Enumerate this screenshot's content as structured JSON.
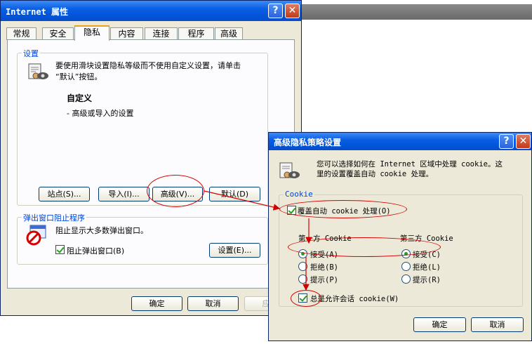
{
  "main_dialog": {
    "title": "Internet 属性",
    "help_label": "?",
    "close_label": "✕",
    "tabs": [
      {
        "label": "常规",
        "active": false
      },
      {
        "label": "安全",
        "active": false
      },
      {
        "label": "隐私",
        "active": true
      },
      {
        "label": "内容",
        "active": false
      },
      {
        "label": "连接",
        "active": false
      },
      {
        "label": "程序",
        "active": false
      },
      {
        "label": "高级",
        "active": false
      }
    ],
    "settings_group": {
      "label": "设置",
      "description": "要使用滑块设置隐私等级而不使用自定义设置，请单击\n“默认”按钮。",
      "level_title": "自定义",
      "level_desc": "- 高级或导入的设置",
      "buttons": {
        "sites": "站点(S)...",
        "import": "导入(I)...",
        "advanced": "高级(V)...",
        "default": "默认(D)"
      }
    },
    "popup_group": {
      "label": "弹出窗口阻止程序",
      "description": "阻止显示大多数弹出窗口。",
      "block_label": "阻止弹出窗口(B)",
      "block_checked": true,
      "settings_button": "设置(E)..."
    },
    "footer": {
      "ok": "确定",
      "cancel": "取消",
      "apply": "应用"
    }
  },
  "advanced_dialog": {
    "title": "高级隐私策略设置",
    "help_label": "?",
    "close_label": "✕",
    "description": "您可以选择如何在 Internet 区域中处理 cookie。这\n里的设置覆盖自动 cookie 处理。",
    "cookie_group_label": "Cookie",
    "override_label": "覆盖自动 cookie 处理(O)",
    "override_checked": true,
    "first_party": {
      "heading": "第一方 Cookie",
      "options": [
        {
          "label": "接受(A)",
          "selected": true
        },
        {
          "label": "拒绝(B)",
          "selected": false
        },
        {
          "label": "提示(P)",
          "selected": false
        }
      ]
    },
    "third_party": {
      "heading": "第三方 Cookie",
      "options": [
        {
          "label": "接受(C)",
          "selected": true
        },
        {
          "label": "拒绝(L)",
          "selected": false
        },
        {
          "label": "提示(R)",
          "selected": false
        }
      ]
    },
    "session_label": "总是允许会话 cookie(W)",
    "session_checked": true,
    "footer": {
      "ok": "确定",
      "cancel": "取消"
    }
  },
  "icons": [
    "privacy-settings-icon",
    "popup-blocker-icon",
    "cookie-settings-icon"
  ],
  "colors": {
    "titlebar": "#0a5ee4",
    "annotation": "#d40000",
    "group_label": "#0046d5",
    "dialog_bg": "#ece9d8"
  }
}
